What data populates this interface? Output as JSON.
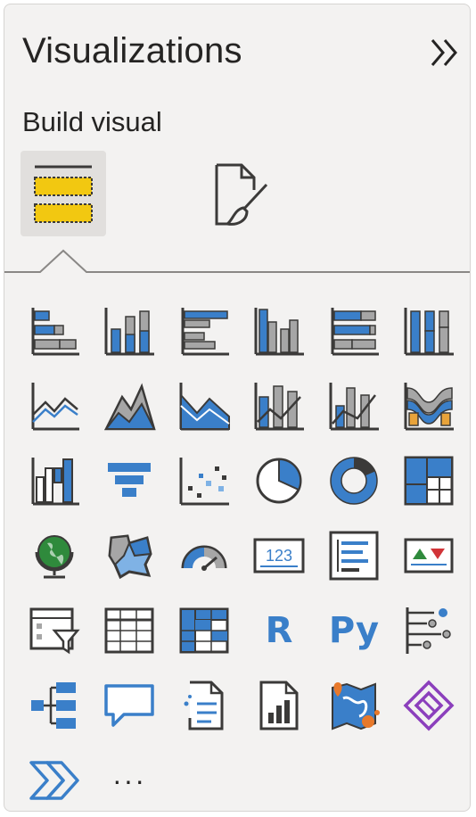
{
  "header": {
    "title": "Visualizations",
    "collapse_icon": "double-chevron-right-icon"
  },
  "section": {
    "subtitle": "Build visual"
  },
  "tabs": [
    {
      "name": "build-visual",
      "icon": "fields-well-icon",
      "active": true
    },
    {
      "name": "format-visual",
      "icon": "format-paintbrush-icon",
      "active": false
    }
  ],
  "visual_icons": [
    [
      "stacked-bar-chart-icon",
      "stacked-column-chart-icon",
      "clustered-bar-chart-icon",
      "clustered-column-chart-icon",
      "100-stacked-bar-chart-icon",
      "100-stacked-column-chart-icon"
    ],
    [
      "line-chart-icon",
      "area-chart-icon",
      "stacked-area-chart-icon",
      "line-and-stacked-column-chart-icon",
      "line-and-clustered-column-chart-icon",
      "ribbon-chart-icon"
    ],
    [
      "waterfall-chart-icon",
      "funnel-chart-icon",
      "scatter-chart-icon",
      "pie-chart-icon",
      "donut-chart-icon",
      "treemap-icon"
    ],
    [
      "map-icon",
      "filled-map-icon",
      "gauge-icon",
      "card-icon",
      "multi-row-card-icon",
      "kpi-icon"
    ],
    [
      "slicer-icon",
      "table-icon",
      "matrix-icon",
      "r-script-visual-icon",
      "python-visual-icon",
      "key-influencers-icon"
    ],
    [
      "decomposition-tree-icon",
      "qna-icon",
      "smart-narrative-icon",
      "paginated-report-icon",
      "arcgis-maps-icon",
      "power-apps-icon"
    ],
    [
      "power-automate-icon",
      "more-visuals-icon"
    ]
  ],
  "labels": {
    "r_text": "R",
    "py_text": "Py",
    "card_text": "123",
    "more_text": "···"
  },
  "colors": {
    "blue": "#3a7fc9",
    "light_blue": "#7fb2e5",
    "gray": "#3b3a39",
    "yellow": "#f2c811",
    "orange": "#e8792b",
    "purple": "#8b3fbc",
    "green": "#2f8a3c"
  }
}
